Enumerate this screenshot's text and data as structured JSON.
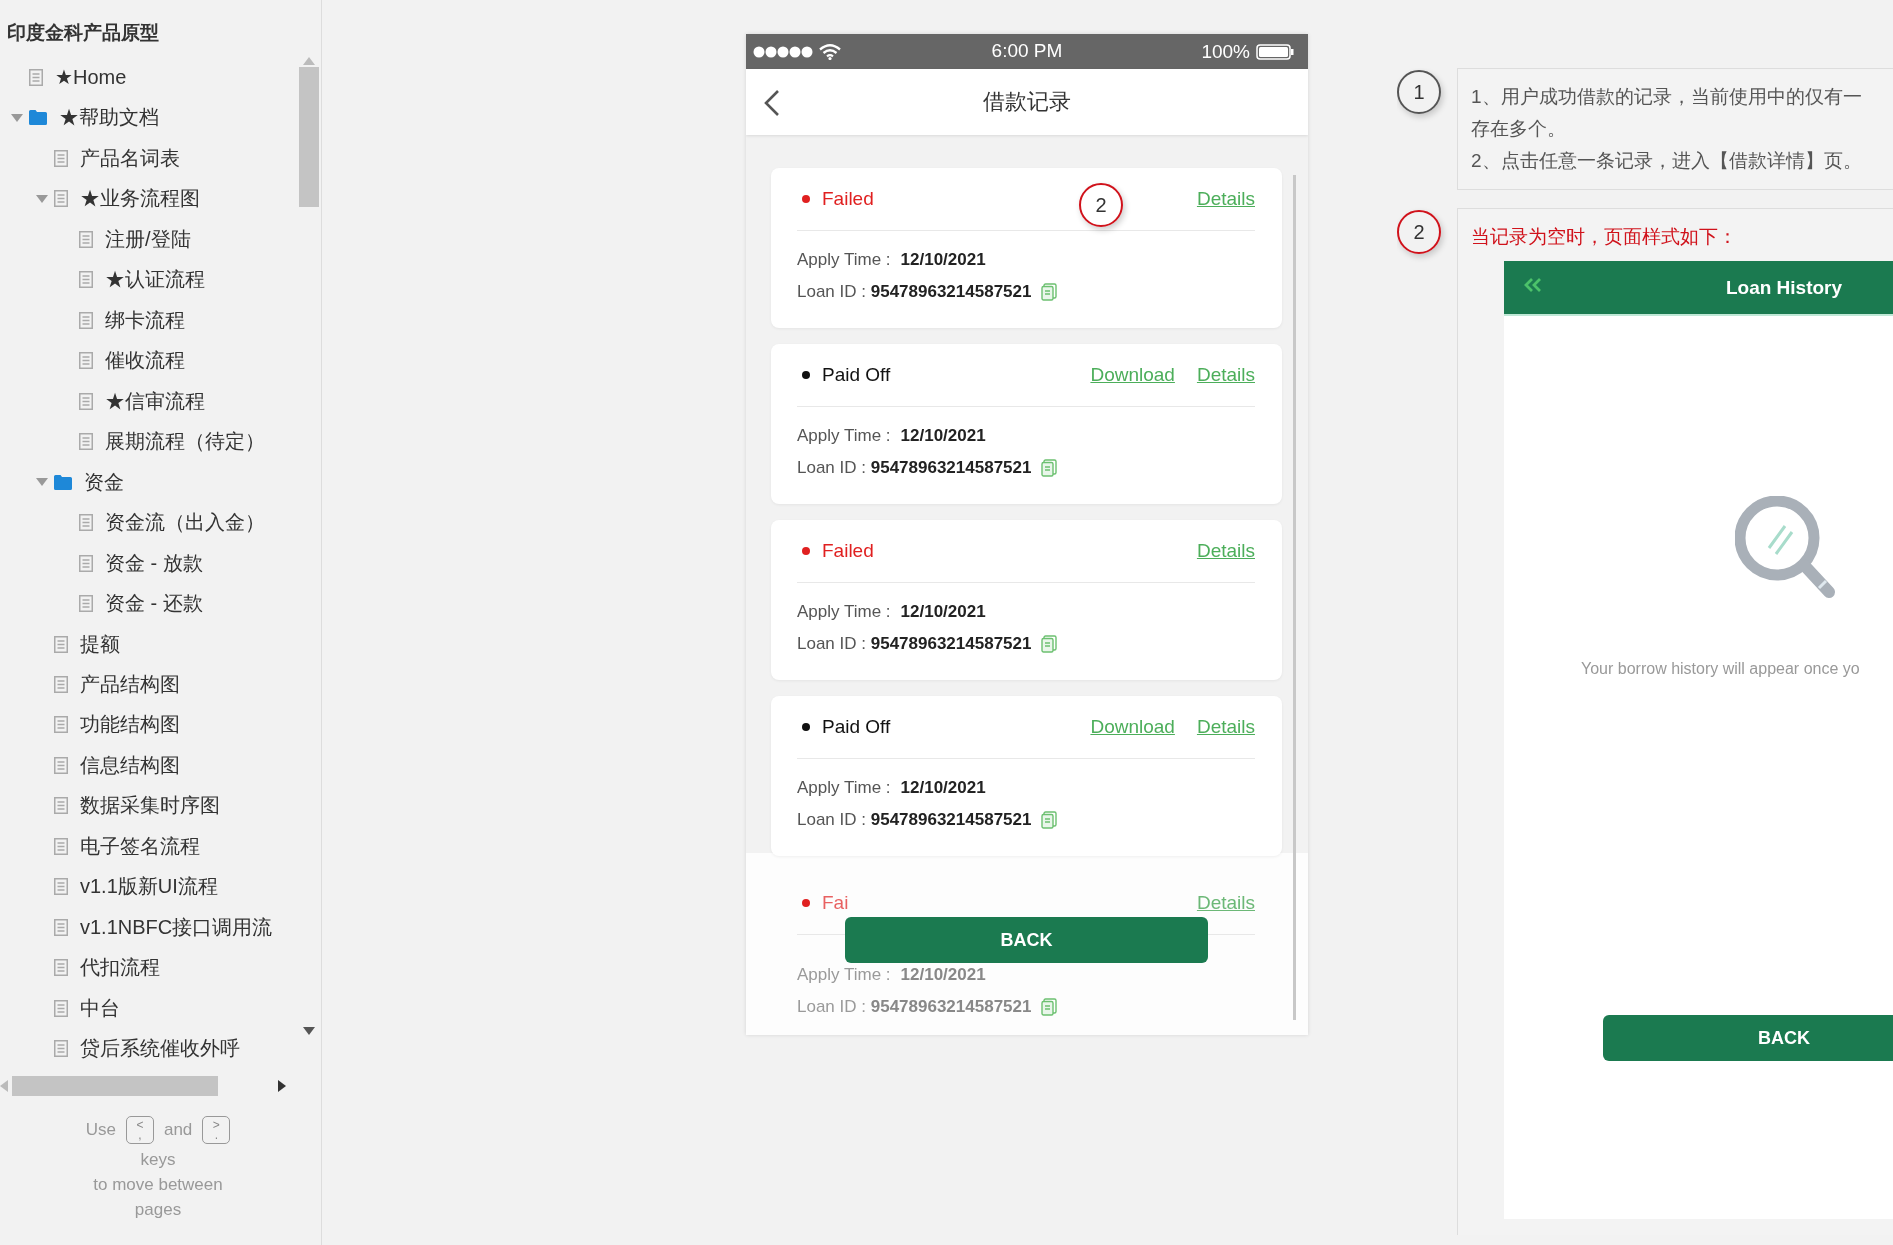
{
  "sidebar": {
    "title": "印度金科产品原型",
    "items": [
      {
        "label": "★Home",
        "kind": "page"
      },
      {
        "label": "★帮助文档",
        "kind": "folder",
        "expanded": true,
        "children": [
          {
            "label": "产品名词表",
            "kind": "page"
          },
          {
            "label": "★业务流程图",
            "kind": "page",
            "expanded": true,
            "children": [
              {
                "label": "注册/登陆",
                "kind": "page"
              },
              {
                "label": "★认证流程",
                "kind": "page"
              },
              {
                "label": "绑卡流程",
                "kind": "page"
              },
              {
                "label": "催收流程",
                "kind": "page"
              },
              {
                "label": "★信审流程",
                "kind": "page"
              },
              {
                "label": "展期流程（待定）",
                "kind": "page"
              }
            ]
          },
          {
            "label": "资金",
            "kind": "folder",
            "expanded": true,
            "children": [
              {
                "label": "资金流（出入金）",
                "kind": "page"
              },
              {
                "label": "资金 - 放款",
                "kind": "page"
              },
              {
                "label": "资金 - 还款",
                "kind": "page"
              }
            ]
          },
          {
            "label": "提额",
            "kind": "page"
          },
          {
            "label": "产品结构图",
            "kind": "page"
          },
          {
            "label": "功能结构图",
            "kind": "page"
          },
          {
            "label": "信息结构图",
            "kind": "page"
          },
          {
            "label": "数据采集时序图",
            "kind": "page"
          },
          {
            "label": "电子签名流程",
            "kind": "page"
          },
          {
            "label": "v1.1版新UI流程",
            "kind": "page"
          },
          {
            "label": "v1.1NBFC接口调用流",
            "kind": "page"
          },
          {
            "label": "代扣流程",
            "kind": "page"
          },
          {
            "label": "中台",
            "kind": "page"
          },
          {
            "label": "贷后系统催收外呼",
            "kind": "page"
          }
        ]
      }
    ],
    "help": {
      "before": "Use",
      "between": "and",
      "after_lines": [
        "keys",
        "to move between",
        "pages"
      ],
      "keys": [
        {
          "top": "<",
          "bottom": ","
        },
        {
          "top": ">",
          "bottom": "."
        }
      ]
    }
  },
  "phone": {
    "status_bar": {
      "time": "6:00 PM",
      "battery": "100%"
    },
    "title": "借款记录",
    "cards": [
      {
        "status": "Failed",
        "color": "#e02020",
        "marker": "2",
        "actions": [
          "Details"
        ],
        "apply": "Apply Time : **12/10/2021**",
        "loan_id": "Loan ID : **95478963214587521**",
        "faded": false
      },
      {
        "status": "Paid Off",
        "color": "#111111",
        "actions": [
          "Download",
          "Details"
        ],
        "apply": "Apply Time : **12/10/2021**",
        "loan_id": "Loan ID : **95478963214587521**",
        "faded": false
      },
      {
        "status": "Failed",
        "color": "#e02020",
        "actions": [
          "Details"
        ],
        "apply": "Apply Time : **12/10/2021**",
        "loan_id": "Loan ID : **95478963214587521**",
        "faded": false
      },
      {
        "status": "Paid Off",
        "color": "#111111",
        "actions": [
          "Download",
          "Details"
        ],
        "apply": "Apply Time : **12/10/2021**",
        "loan_id": "Loan ID : **95478963214587521**",
        "faded": false
      },
      {
        "status": "Fai",
        "color": "#e02020",
        "actions": [
          "Details"
        ],
        "apply": "Apply Time : **12/10/2021**",
        "loan_id": "Loan ID : **95478963214587521**",
        "faded": true
      }
    ],
    "button": "BACK"
  },
  "notes": [
    {
      "number": "1",
      "color": "#555555",
      "lines": [
        "1、用户成功借款的记录，当前使用中的仅有一",
        "存在多个。",
        "2、点击任意一条记录，进入【借款详情】页。"
      ]
    },
    {
      "number": "2",
      "color": "#d0121b",
      "lines": [
        "当记录为空时，页面样式如下："
      ],
      "mockup": {
        "title": "Loan History",
        "message": "Your borrow history will appear once yo",
        "button": "BACK"
      }
    }
  ]
}
